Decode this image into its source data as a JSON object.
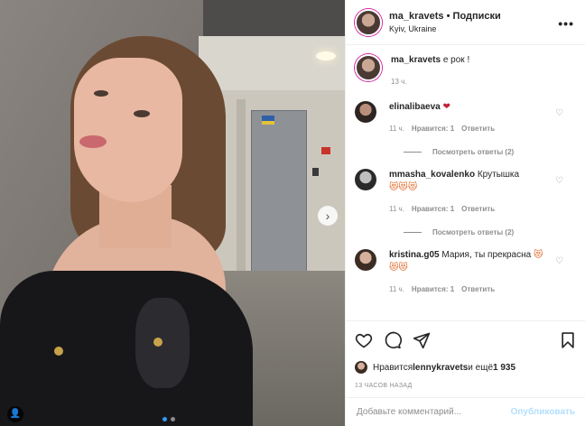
{
  "header": {
    "username": "ma_kravets",
    "separator": " • ",
    "follow_label": "Подписки",
    "location": "Kyiv, Ukraine",
    "more_label": "•••"
  },
  "caption": {
    "username": "ma_kravets",
    "text": " е рок !",
    "time": "13 ч."
  },
  "comments": [
    {
      "username": "elinalibaeva",
      "text": " ",
      "emoji": "❤",
      "time": "11 ч.",
      "likes": "Нравится: 1",
      "reply": "Ответить",
      "replies_label": "Посмотреть ответы (2)"
    },
    {
      "username": "mmasha_kovalenko",
      "text": " Крутышка",
      "emoji": "😻😻😻",
      "time": "11 ч.",
      "likes": "Нравится: 1",
      "reply": "Ответить",
      "replies_label": "Посмотреть ответы (2)"
    },
    {
      "username": "kristina.g05",
      "text": " Мария, ты прекрасна",
      "emoji": " 😻😻😻",
      "time": "11 ч.",
      "likes": "Нравится: 1",
      "reply": "Ответить"
    }
  ],
  "actions": {
    "like_icon": "heart-outline-icon",
    "comment_icon": "comment-icon",
    "share_icon": "share-icon",
    "save_icon": "bookmark-icon"
  },
  "likes": {
    "prefix": "Нравится ",
    "user": "lennykravets",
    "middle": " и ещё ",
    "count": "1 935"
  },
  "post_time": "13 ЧАСОВ НАЗАД",
  "comment_input": {
    "placeholder": "Добавьте комментарий...",
    "publish_label": "Опубликовать"
  },
  "photo": {
    "next_icon": "›",
    "tag_icon": "👤"
  },
  "colors": {
    "accent": "#3897f0",
    "publish_disabled": "#b2dffc",
    "muted": "#8e8e8e"
  }
}
